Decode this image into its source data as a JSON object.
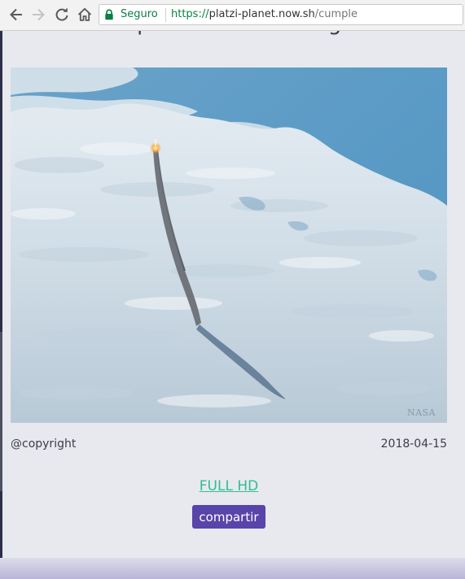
{
  "browser": {
    "security_label": "Seguro",
    "url_scheme": "https://",
    "url_host": "platzi-planet.now.sh",
    "url_path": "/cumple"
  },
  "icons": {
    "back": "arrow-left",
    "forward": "arrow-right",
    "reload": "circular-arrow",
    "home": "house",
    "secure": "padlock"
  },
  "page": {
    "title": "Space Shuttle Rising",
    "photo_credit": "NASA",
    "copyright": "@copyright",
    "date": "2018-04-15",
    "hd_link": "FULL HD",
    "share_button": "compartir"
  },
  "colors": {
    "page_background": "#e8e9ee",
    "link": "#2fbf8f",
    "button": "#5944a9",
    "secure": "#0b8043"
  }
}
